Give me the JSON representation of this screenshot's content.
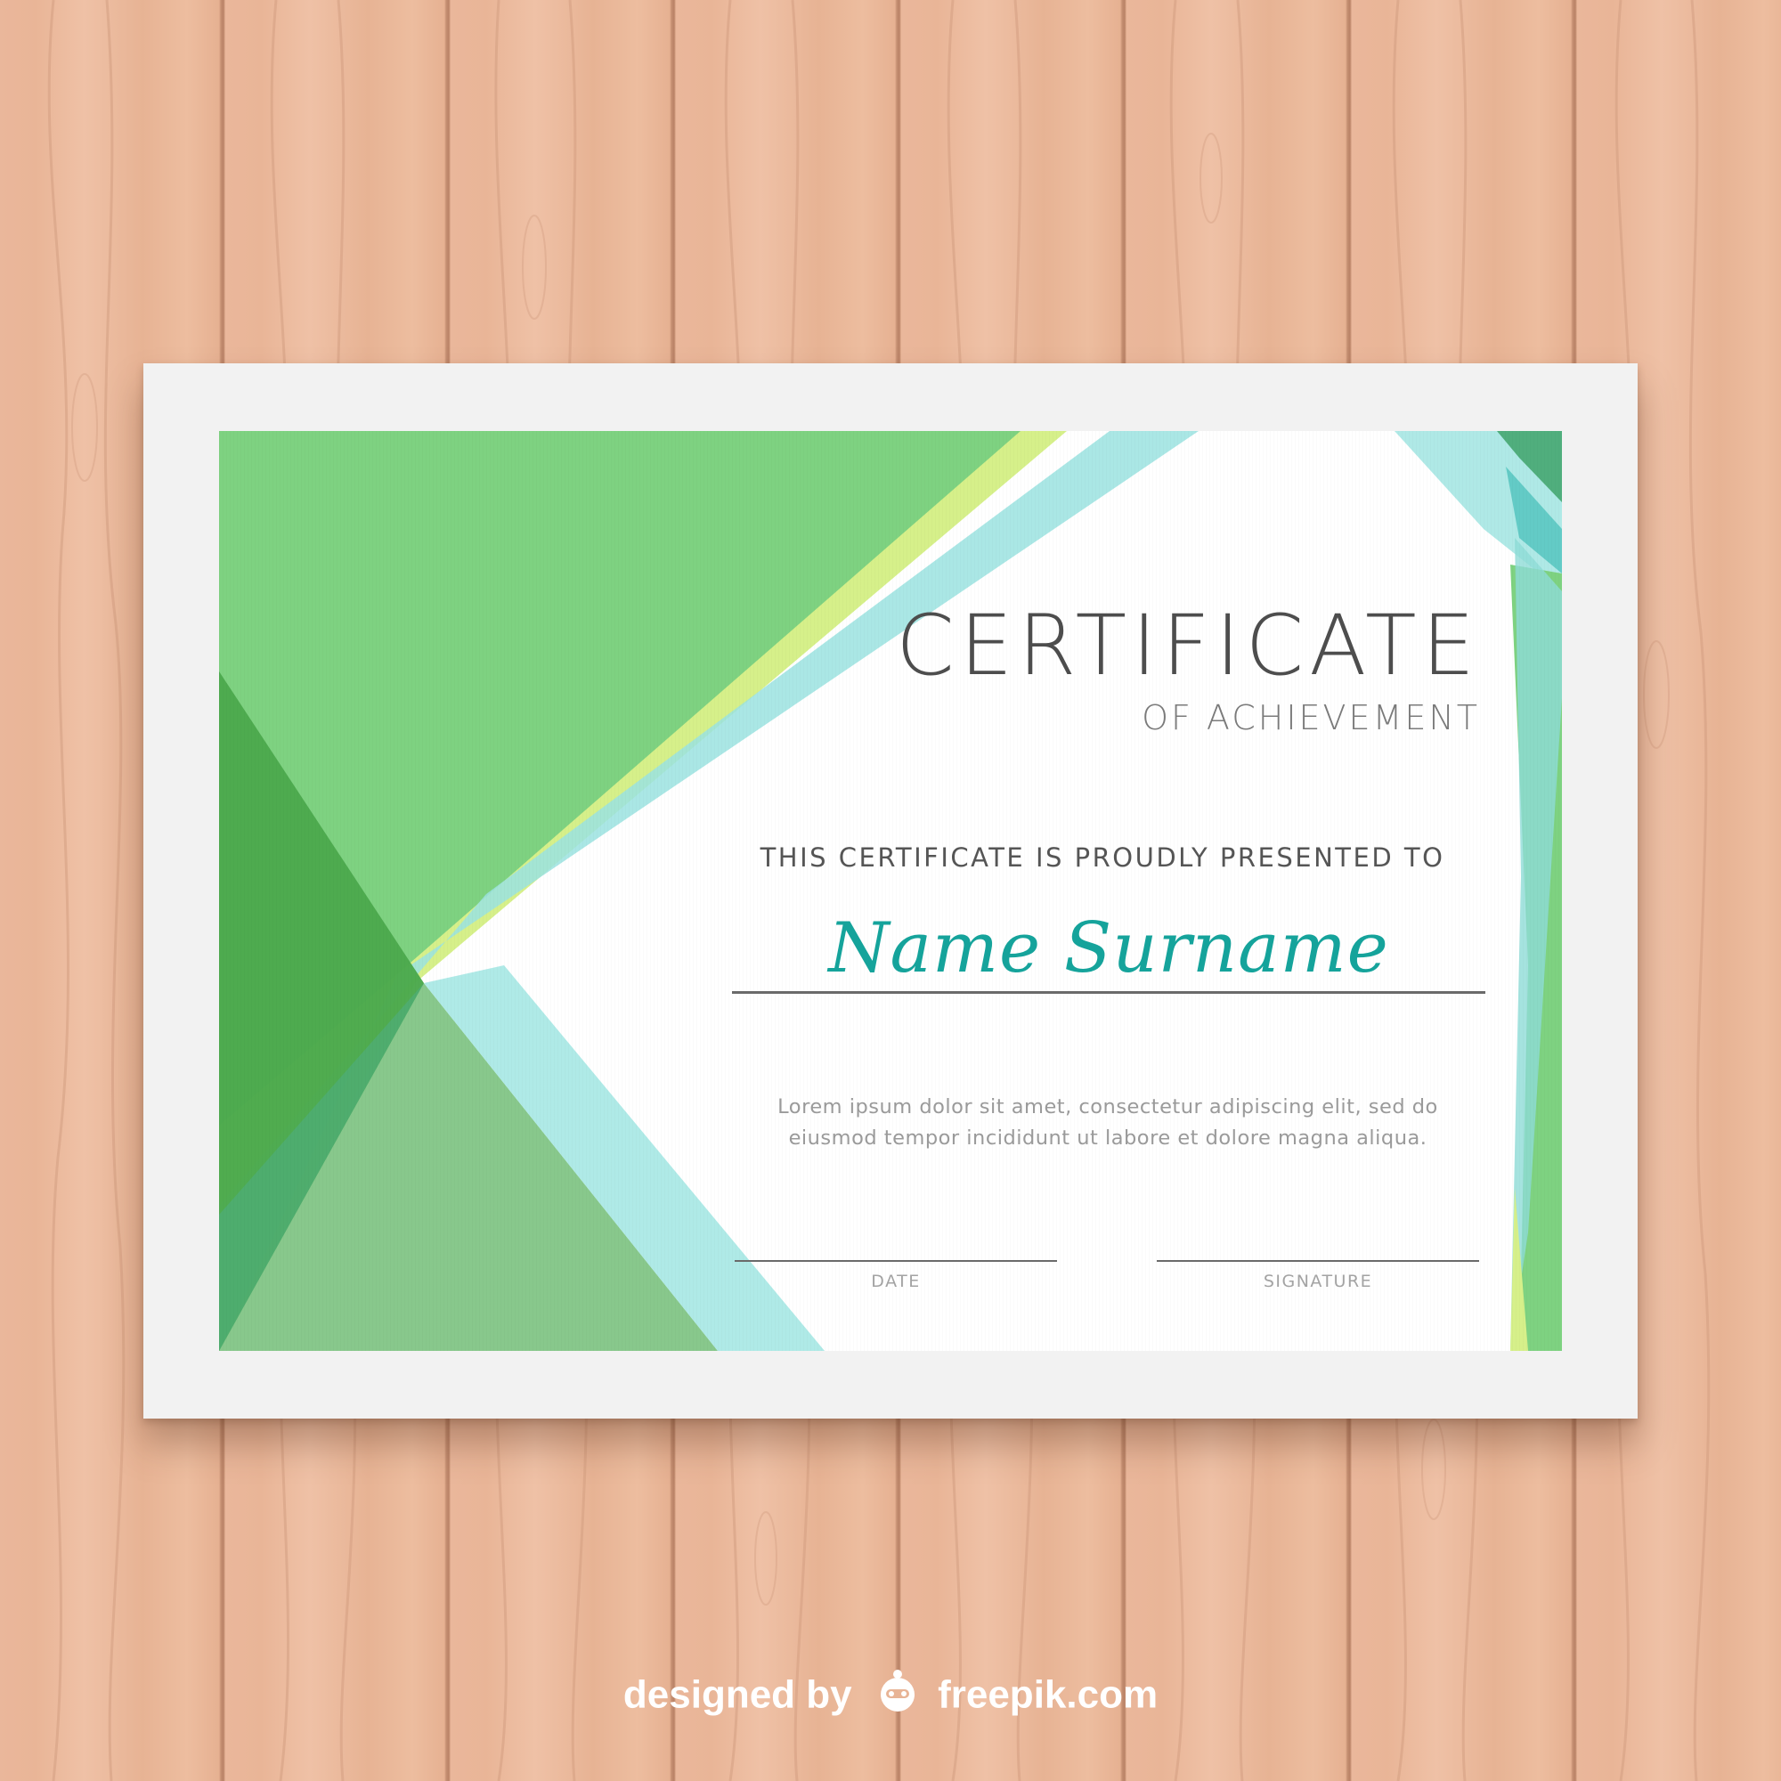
{
  "certificate": {
    "title": "CERTIFICATE",
    "subtitle": "OF ACHIEVEMENT",
    "presented_to": "THIS CERTIFICATE IS PROUDLY PRESENTED TO",
    "recipient_name": "Name Surname",
    "body_lines": [
      "Lorem ipsum dolor sit amet, consectetur adipiscing elit, sed do",
      "eiusmod tempor incididunt ut labore et dolore magna aliqua."
    ],
    "date_label": "DATE",
    "signature_label": "SIGNATURE"
  },
  "credit": {
    "designed_by": "designed by",
    "site": "freepik.com"
  },
  "colors": {
    "background_wood": "#e8b496",
    "frame": "#f2f2f2",
    "primary_green": "#7ed281",
    "dark_green": "#3fa33f",
    "teal": "#7fd9d4",
    "lime": "#d6f08a",
    "name_accent": "#15a39b",
    "text_dark": "#4d4d4d"
  },
  "icons": {
    "credit_logo": "freepik-logo-icon"
  }
}
